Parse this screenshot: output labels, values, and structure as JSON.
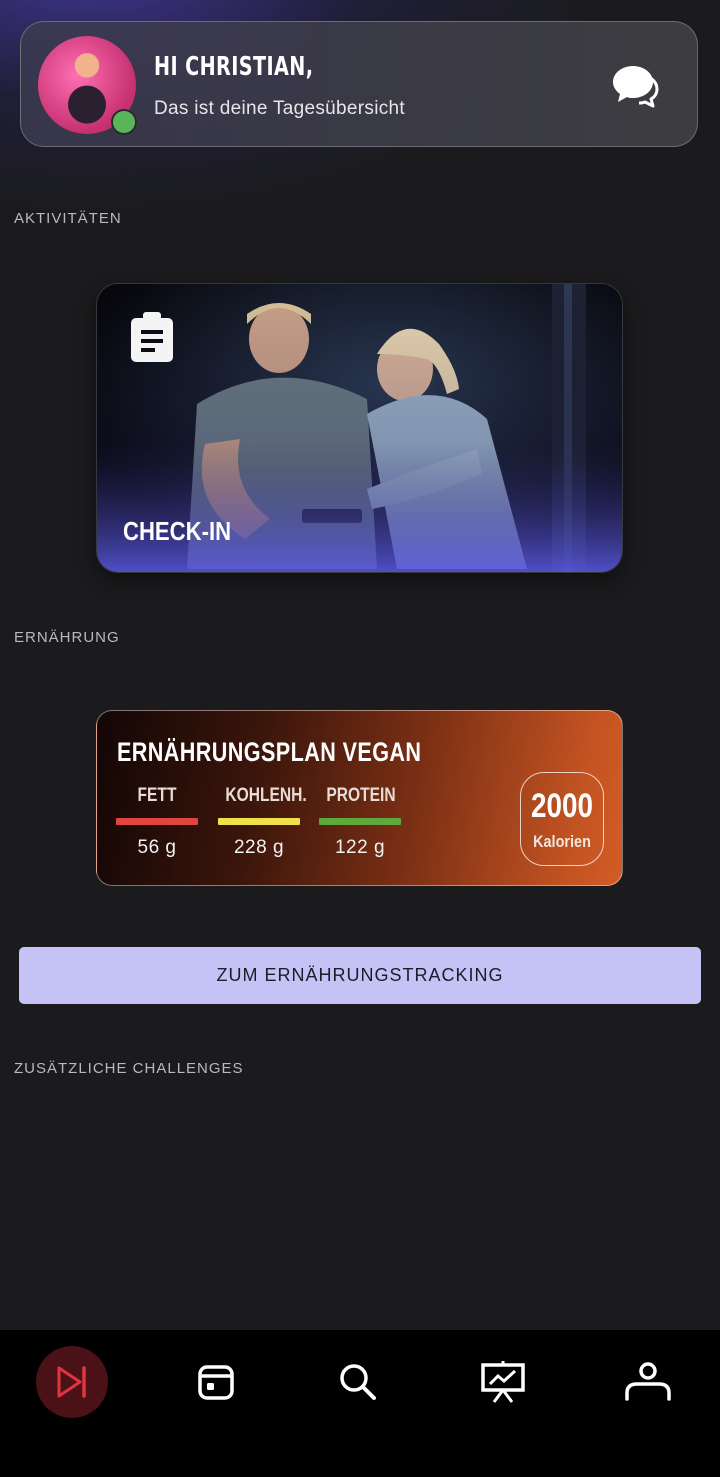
{
  "header": {
    "greeting": "HI CHRISTIAN,",
    "subtitle": "Das ist deine Tagesübersicht",
    "avatar_icon": "avatar",
    "status": "online",
    "chat_icon": "chat-bubbles-icon"
  },
  "sections": {
    "activities": "AKTIVITÄTEN",
    "nutrition": "ERNÄHRUNG",
    "challenges": "ZUSÄTZLICHE CHALLENGES"
  },
  "checkin": {
    "label": "CHECK-IN",
    "icon": "clipboard-icon"
  },
  "nutrition_plan": {
    "title": "ERNÄHRUNGSPLAN VEGAN",
    "macros": [
      {
        "label": "FETT",
        "value": "56 g",
        "color": "#e0463f"
      },
      {
        "label": "KOHLENH.",
        "value": "228 g",
        "color": "#f0e04a"
      },
      {
        "label": "PROTEIN",
        "value": "122 g",
        "color": "#5ea83e"
      }
    ],
    "calories_value": "2000",
    "calories_label": "Kalorien"
  },
  "tracking_button": "ZUM ERNÄHRUNGSTRACKING",
  "nav": {
    "items": [
      {
        "name": "skip-forward-icon",
        "active": true
      },
      {
        "name": "calendar-icon",
        "active": false
      },
      {
        "name": "search-icon",
        "active": false
      },
      {
        "name": "presentation-chart-icon",
        "active": false
      },
      {
        "name": "profile-icon",
        "active": false
      }
    ],
    "active_color": "#e0353f"
  }
}
